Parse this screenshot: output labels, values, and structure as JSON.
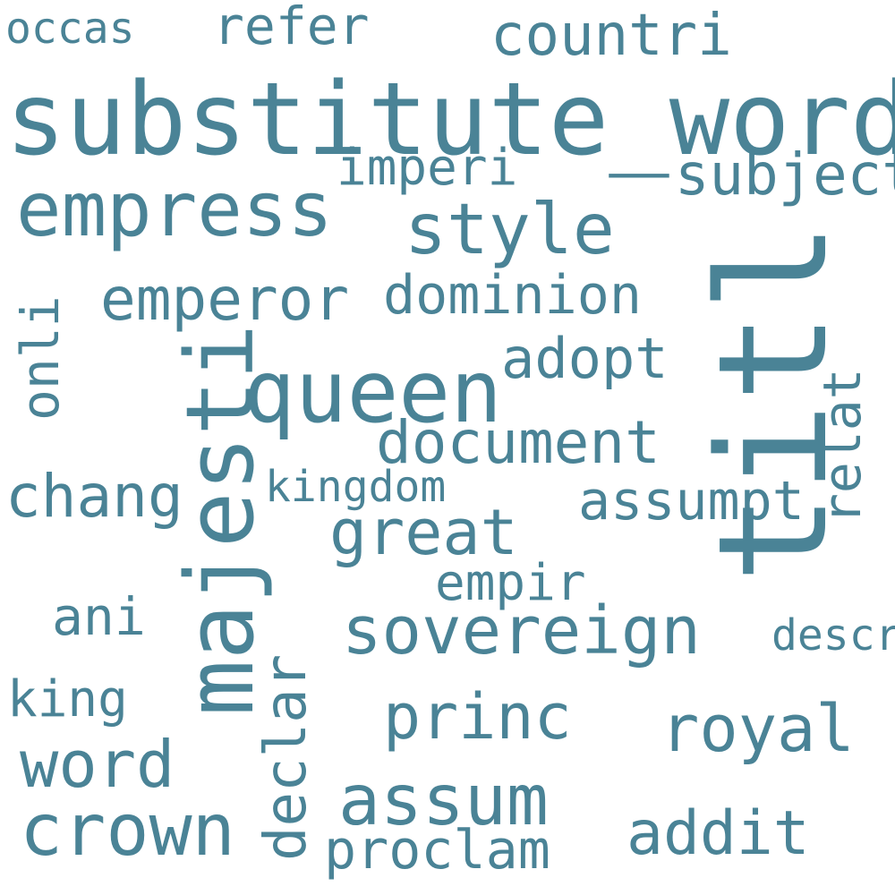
{
  "color": "#4a8396",
  "words": [
    {
      "id": "substitute_word",
      "text": "substitute_word"
    },
    {
      "id": "titl",
      "text": "titl"
    },
    {
      "id": "majesti",
      "text": "majesti"
    },
    {
      "id": "queen",
      "text": "queen"
    },
    {
      "id": "empress",
      "text": "empress"
    },
    {
      "id": "style",
      "text": "style"
    },
    {
      "id": "crown",
      "text": "crown"
    },
    {
      "id": "sovereign",
      "text": "sovereign"
    },
    {
      "id": "assum",
      "text": "assum"
    },
    {
      "id": "word",
      "text": "word"
    },
    {
      "id": "royal",
      "text": "royal"
    },
    {
      "id": "document",
      "text": "document"
    },
    {
      "id": "emperor",
      "text": "emperor"
    },
    {
      "id": "great",
      "text": "great"
    },
    {
      "id": "princ",
      "text": "princ"
    },
    {
      "id": "addit",
      "text": "addit"
    },
    {
      "id": "countri",
      "text": "countri"
    },
    {
      "id": "dominion",
      "text": "dominion"
    },
    {
      "id": "adopt",
      "text": "adopt"
    },
    {
      "id": "chang",
      "text": "chang"
    },
    {
      "id": "proclam",
      "text": "proclam"
    },
    {
      "id": "subject",
      "text": "subject"
    },
    {
      "id": "imperi",
      "text": "imperi"
    },
    {
      "id": "declar",
      "text": "declar"
    },
    {
      "id": "assumpt",
      "text": "assumpt"
    },
    {
      "id": "ani",
      "text": "ani"
    },
    {
      "id": "king",
      "text": "king"
    },
    {
      "id": "empir",
      "text": "empir"
    },
    {
      "id": "relat",
      "text": "relat"
    },
    {
      "id": "refer",
      "text": "refer"
    },
    {
      "id": "occas",
      "text": "occas"
    },
    {
      "id": "kingdom",
      "text": "kingdom"
    },
    {
      "id": "describ",
      "text": "describ"
    },
    {
      "id": "onli",
      "text": "onli"
    }
  ]
}
